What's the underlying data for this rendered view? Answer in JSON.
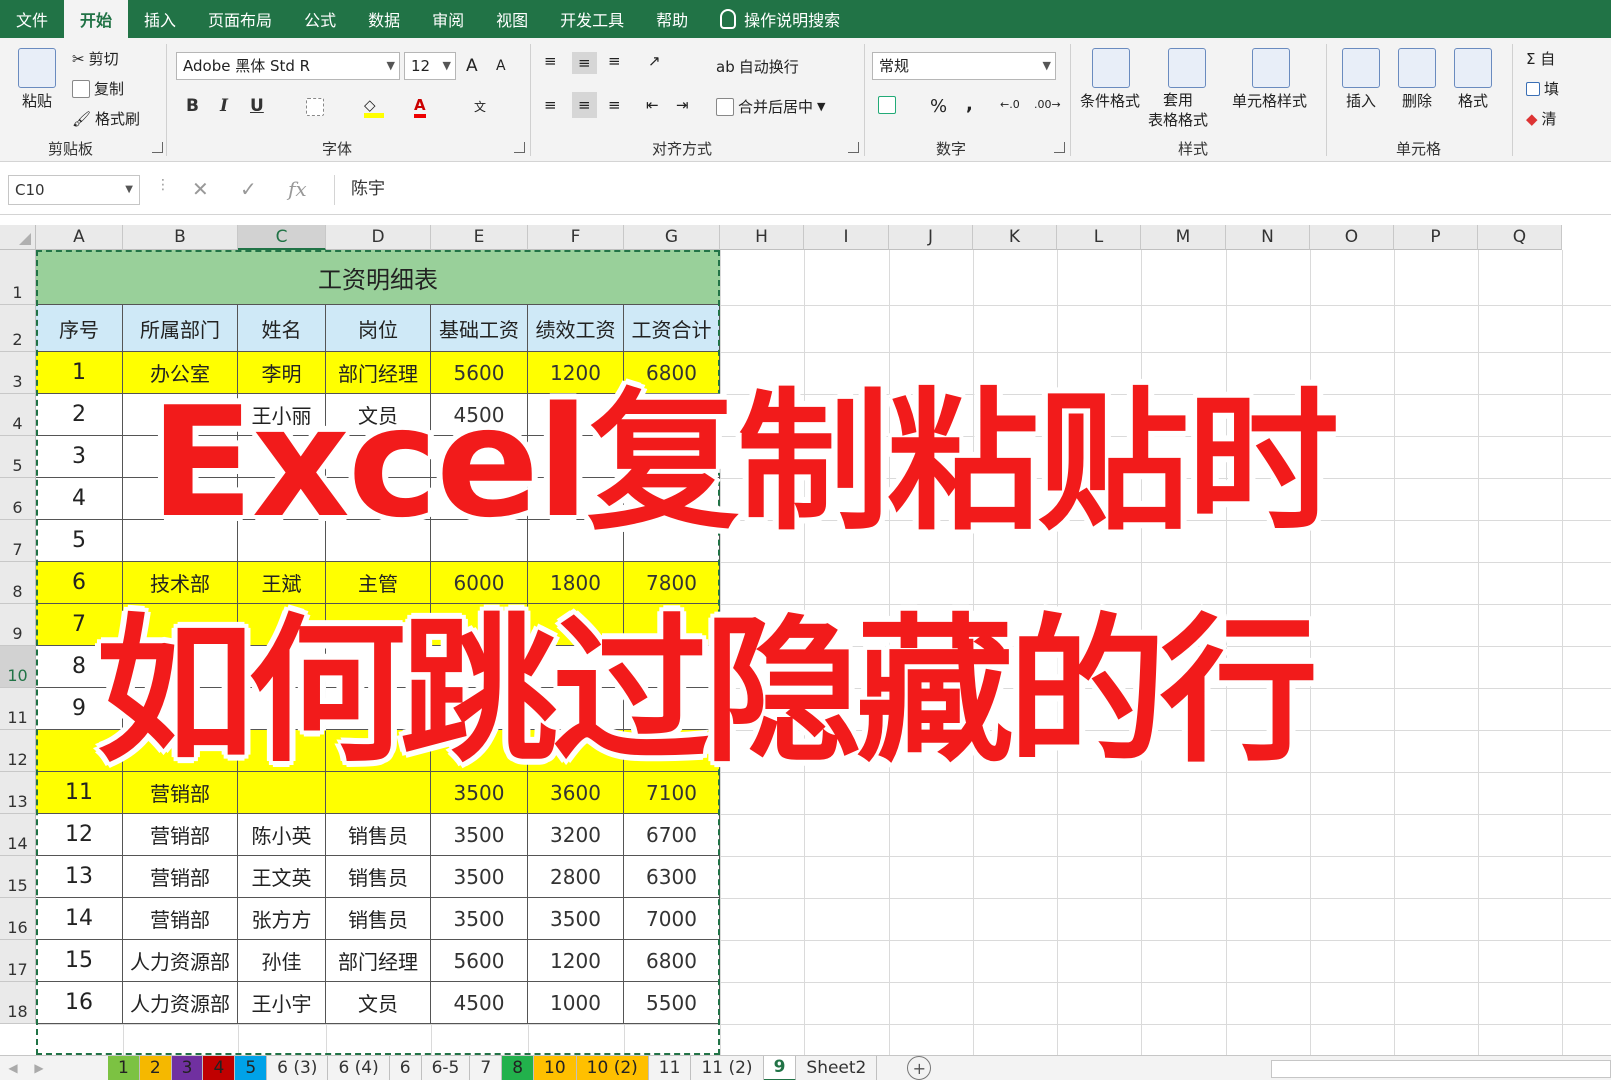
{
  "menu": {
    "tabs": [
      "文件",
      "开始",
      "插入",
      "页面布局",
      "公式",
      "数据",
      "审阅",
      "视图",
      "开发工具",
      "帮助"
    ],
    "active_index": 1,
    "tellme": "操作说明搜索"
  },
  "ribbon": {
    "clipboard": {
      "paste": "粘贴",
      "cut": "剪切",
      "copy": "复制",
      "format_painter": "格式刷",
      "label": "剪贴板"
    },
    "font": {
      "name": "Adobe 黑体 Std R",
      "size": "12",
      "grow": "A",
      "shrink": "A",
      "bold": "B",
      "italic": "I",
      "underline": "U",
      "label": "字体"
    },
    "alignment": {
      "wrap": "自动换行",
      "merge": "合并后居中",
      "label": "对齐方式"
    },
    "number": {
      "format": "常规",
      "percent": "%",
      "comma": ",",
      "label": "数字"
    },
    "styles": {
      "conditional": "条件格式",
      "table": "套用\n表格格式",
      "cell_styles": "单元格样式",
      "label": "样式"
    },
    "cells": {
      "insert": "插入",
      "delete": "删除",
      "format": "格式",
      "label": "单元格"
    },
    "editing": {
      "autosum": "Σ 自",
      "fill": "填",
      "clear": "清"
    }
  },
  "formula_bar": {
    "name_box": "C10",
    "formula": "陈宇"
  },
  "columns": [
    "A",
    "B",
    "C",
    "D",
    "E",
    "F",
    "G",
    "H",
    "I",
    "J",
    "K",
    "L",
    "M",
    "N",
    "O",
    "P",
    "Q"
  ],
  "selected_column": "C",
  "rows": [
    "1",
    "2",
    "3",
    "4",
    "5",
    "6",
    "7",
    "8",
    "9",
    "10",
    "11",
    "12",
    "13",
    "14",
    "15",
    "16",
    "17",
    "18"
  ],
  "selected_row": "10",
  "table": {
    "title": "工资明细表",
    "headers": [
      "序号",
      "所属部门",
      "姓名",
      "岗位",
      "基础工资",
      "绩效工资",
      "工资合计"
    ],
    "visible": [
      {
        "row": 0,
        "cells": [
          "1",
          "办公室",
          "李明",
          "部门经理",
          "5600",
          "1200",
          "6800"
        ],
        "highlight": true
      },
      {
        "row": 1,
        "cells": [
          "2",
          "",
          "王小丽",
          "文员",
          "4500",
          "",
          ""
        ],
        "highlight": false
      },
      {
        "row": 2,
        "cells": [
          "3",
          "",
          "",
          "",
          "",
          "",
          ""
        ],
        "highlight": false
      },
      {
        "row": 3,
        "cells": [
          "4",
          "",
          "",
          "",
          "",
          "",
          ""
        ],
        "highlight": false
      },
      {
        "row": 4,
        "cells": [
          "5",
          "",
          "",
          "",
          "",
          "",
          ""
        ],
        "highlight": false
      },
      {
        "row": 5,
        "cells": [
          "6",
          "技术部",
          "王斌",
          "主管",
          "6000",
          "1800",
          "7800"
        ],
        "highlight": true
      },
      {
        "row": 6,
        "cells": [
          "7",
          "",
          "",
          "",
          "",
          "",
          ""
        ],
        "highlight": true
      },
      {
        "row": 7,
        "cells": [
          "8",
          "",
          "",
          "",
          "",
          "",
          ""
        ],
        "highlight": false
      },
      {
        "row": 8,
        "cells": [
          "9",
          "",
          "",
          "",
          "",
          "",
          ""
        ],
        "highlight": false
      },
      {
        "row": 9,
        "cells": [
          "",
          "",
          "",
          "",
          "",
          "",
          ""
        ],
        "highlight": true
      },
      {
        "row": 10,
        "cells": [
          "11",
          "营销部",
          "",
          "",
          "3500",
          "3600",
          "7100"
        ],
        "highlight": true
      },
      {
        "row": 11,
        "cells": [
          "12",
          "营销部",
          "陈小英",
          "销售员",
          "3500",
          "3200",
          "6700"
        ],
        "highlight": false
      },
      {
        "row": 12,
        "cells": [
          "13",
          "营销部",
          "王文英",
          "销售员",
          "3500",
          "2800",
          "6300"
        ],
        "highlight": false
      },
      {
        "row": 13,
        "cells": [
          "14",
          "营销部",
          "张方方",
          "销售员",
          "3500",
          "3500",
          "7000"
        ],
        "highlight": false
      },
      {
        "row": 14,
        "cells": [
          "15",
          "人力资源部",
          "孙佳",
          "部门经理",
          "5600",
          "1200",
          "6800"
        ],
        "highlight": false
      },
      {
        "row": 15,
        "cells": [
          "16",
          "人力资源部",
          "王小宇",
          "文员",
          "4500",
          "1000",
          "5500"
        ],
        "highlight": false
      }
    ]
  },
  "overlay": {
    "line1": "Excel复制粘贴时",
    "line2": "如何跳过隐藏的行"
  },
  "sheet_tabs": [
    {
      "label": "1",
      "color": "#7cc242"
    },
    {
      "label": "2",
      "color": "#f5b800"
    },
    {
      "label": "3",
      "color": "#7030a0"
    },
    {
      "label": "4",
      "color": "#c00000"
    },
    {
      "label": "5",
      "color": "#00a2e8"
    },
    {
      "label": "6 (3)",
      "color": ""
    },
    {
      "label": "6 (4)",
      "color": ""
    },
    {
      "label": "6",
      "color": ""
    },
    {
      "label": "6-5",
      "color": ""
    },
    {
      "label": "7",
      "color": ""
    },
    {
      "label": "8",
      "color": "#22b14c"
    },
    {
      "label": "10",
      "color": "#ffc000"
    },
    {
      "label": "10 (2)",
      "color": "#ffc000"
    },
    {
      "label": "11",
      "color": ""
    },
    {
      "label": "11 (2)",
      "color": ""
    },
    {
      "label": "9",
      "color": "",
      "active": true
    },
    {
      "label": "Sheet2",
      "color": ""
    }
  ],
  "colors": {
    "accent": "#217346",
    "title_fill": "#99d09a",
    "header_fill": "#cfe9f7",
    "highlight_fill": "#ffff00",
    "overlay": "#f21b1b"
  }
}
